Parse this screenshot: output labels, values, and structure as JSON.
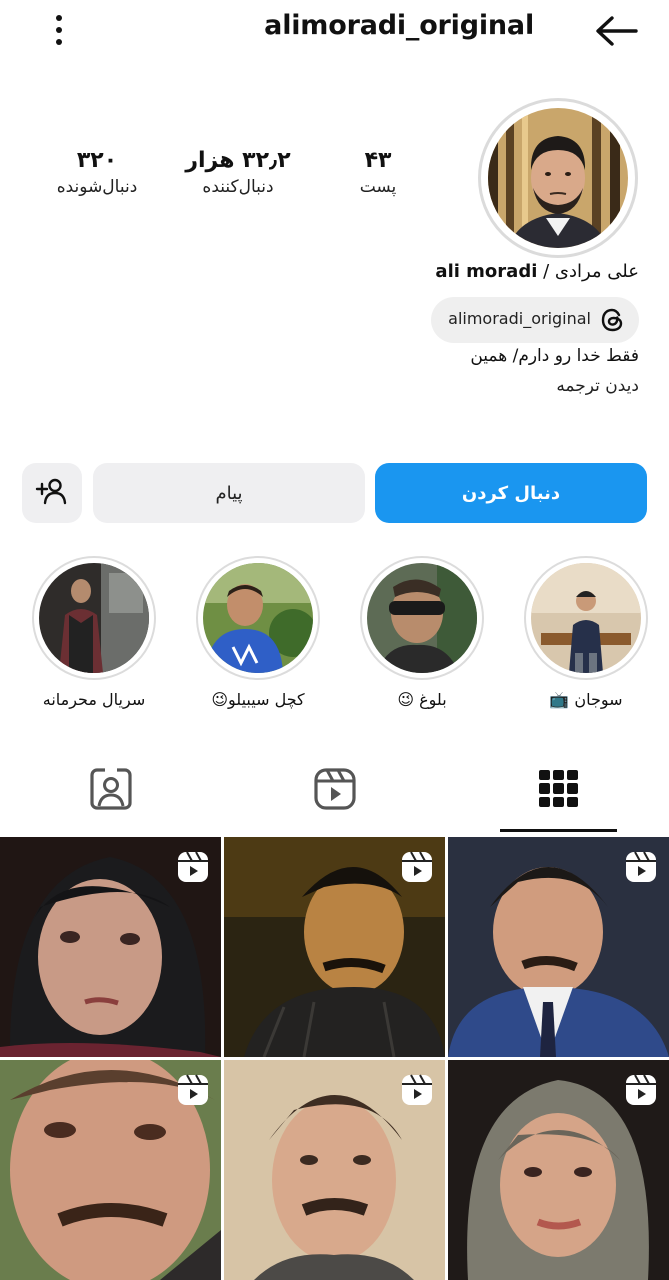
{
  "header": {
    "username": "alimoradi_original",
    "menu_icon": "more-vertical-icon",
    "back_icon": "arrow-left-icon"
  },
  "profile": {
    "avatar": "profile-photo",
    "stats": [
      {
        "value": "۴۳",
        "label": "پست"
      },
      {
        "value": "۳۲٫۲ هزار",
        "label": "دنبال‌کننده"
      },
      {
        "value": "۳۲۰",
        "label": "دنبال‌شونده"
      }
    ],
    "fullname_fa": "علی مرادی /",
    "fullname_en": "ali moradi",
    "threads_handle": "alimoradi_original",
    "bio": "فقط خدا رو دارم/ همین",
    "translate": "دیدن ترجمه"
  },
  "actions": {
    "follow": "دنبال کردن",
    "message": "پیام",
    "add_user_icon": "add-user-icon"
  },
  "highlights": [
    {
      "label": "سوجان 📺"
    },
    {
      "label": "بلوغ 😉"
    },
    {
      "label": "کچل سیبیلو😉"
    },
    {
      "label": "سریال محرمانه"
    }
  ],
  "tabs": [
    {
      "name": "posts-grid",
      "icon": "grid-icon",
      "active": true
    },
    {
      "name": "reels",
      "icon": "reels-icon",
      "active": false
    },
    {
      "name": "tagged",
      "icon": "tagged-person-icon",
      "active": false
    }
  ],
  "colors": {
    "accent": "#1a96f0",
    "button_bg": "#efeff1",
    "chip_bg": "#efefef"
  },
  "grid": [
    {
      "icon": "reel-icon"
    },
    {
      "icon": "reel-icon"
    },
    {
      "icon": "reel-icon"
    },
    {
      "icon": "reel-icon"
    },
    {
      "icon": "reel-icon"
    },
    {
      "icon": "reel-icon"
    }
  ]
}
